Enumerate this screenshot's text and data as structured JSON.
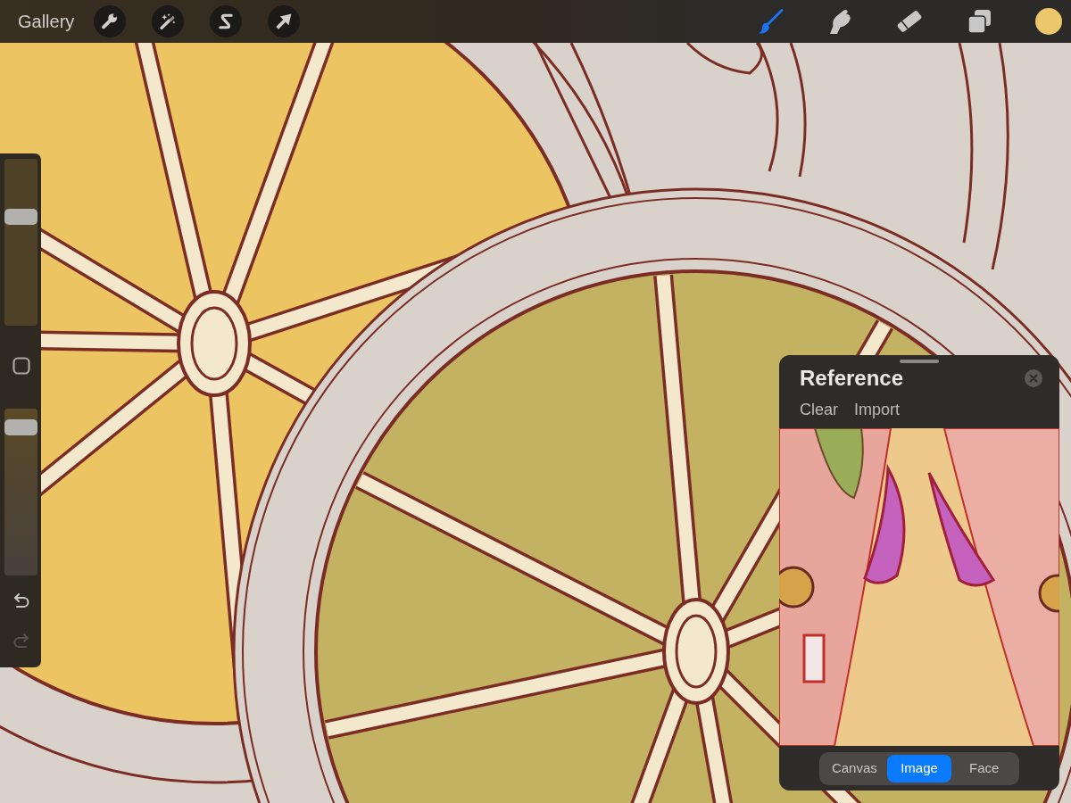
{
  "top_bar": {
    "gallery_label": "Gallery",
    "tools": [
      {
        "kind": "brush",
        "selected": true
      },
      {
        "kind": "smudge",
        "selected": false
      },
      {
        "kind": "eraser",
        "selected": false
      }
    ],
    "current_color": {
      "color": "#eec76b"
    }
  },
  "sidebar": {
    "size_slider": {
      "level": 0.67
    },
    "opacity_slider": {
      "level": 0.93
    },
    "undo": {
      "disabled": false
    },
    "redo": {
      "disabled": true
    }
  },
  "reference_panel": {
    "title": "Reference",
    "actions": [
      "Clear",
      "Import"
    ],
    "segments": [
      {
        "label": "Canvas",
        "selected": false
      },
      {
        "label": "Image",
        "selected": true
      },
      {
        "label": "Face",
        "selected": false
      }
    ]
  }
}
